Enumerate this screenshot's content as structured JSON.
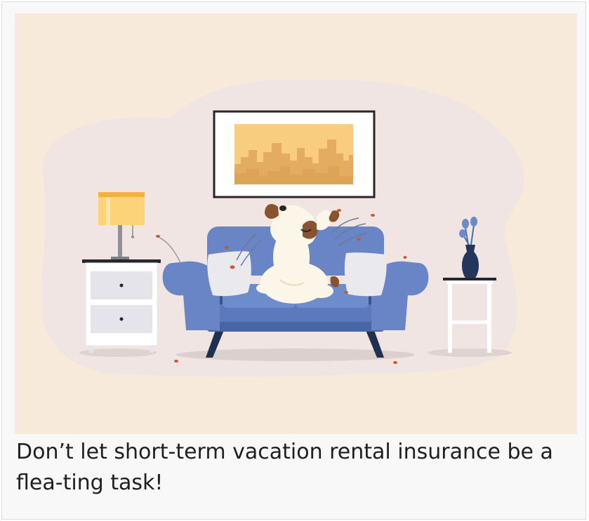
{
  "caption": {
    "text": "Don’t let short-term vacation rental insurance be a flea-ting task!"
  },
  "illustration": {
    "subject": "dog-scratching-fleas-on-sofa",
    "colors": {
      "background": "#f8eadb",
      "room_blob": "#f0e5e2",
      "sofa": "#6985c6",
      "sofa_dark": "#3a5390",
      "sofa_legs": "#203050",
      "lamp_shade": "#fcd378",
      "lamp_band": "#f4b13b",
      "painting": "#f8cd80",
      "skyline": "#e3ac60",
      "dog": "#fbf6e8",
      "dog_patch": "#8a522e",
      "flea": "#c75a25",
      "vase": "#25365c",
      "tulip": "#6c89c8"
    },
    "icons": [
      "lamp-icon",
      "picture-frame-icon",
      "sofa-icon",
      "dog-icon",
      "vase-icon",
      "nightstand-icon",
      "side-table-icon",
      "flea-icon"
    ]
  }
}
